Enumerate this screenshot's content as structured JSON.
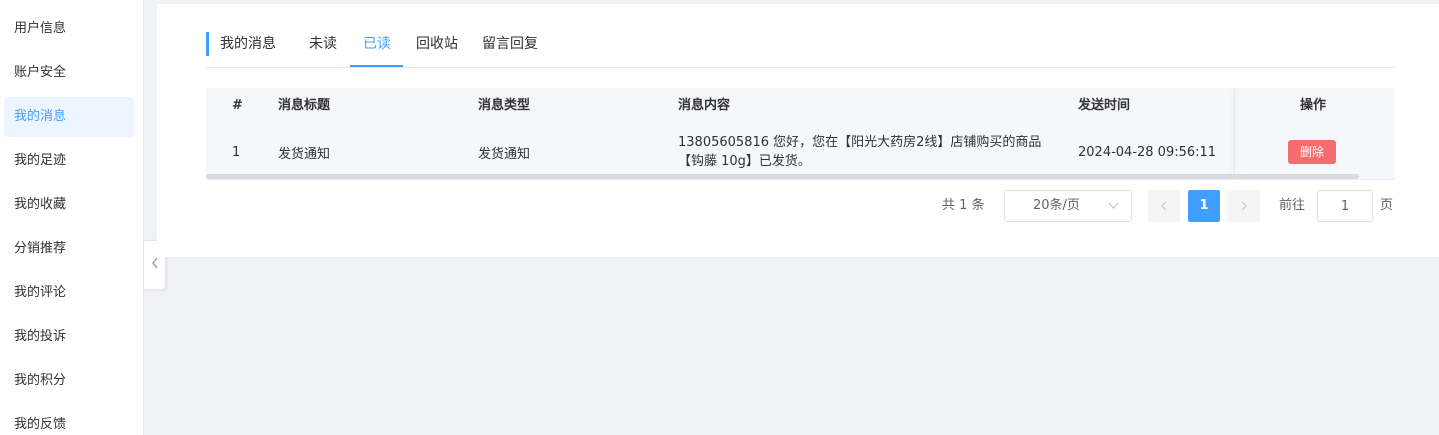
{
  "sidebar": {
    "items": [
      {
        "label": "用户信息"
      },
      {
        "label": "账户安全"
      },
      {
        "label": "我的消息"
      },
      {
        "label": "我的足迹"
      },
      {
        "label": "我的收藏"
      },
      {
        "label": "分销推荐"
      },
      {
        "label": "我的评论"
      },
      {
        "label": "我的投诉"
      },
      {
        "label": "我的积分"
      },
      {
        "label": "我的反馈"
      }
    ],
    "active_item": "我的消息"
  },
  "collapse_icon": "chevron-left-icon",
  "tabs": {
    "items": [
      {
        "label": "我的消息"
      },
      {
        "label": "未读"
      },
      {
        "label": "已读"
      },
      {
        "label": "回收站"
      },
      {
        "label": "留言回复"
      }
    ],
    "active_tab": "已读"
  },
  "table": {
    "headers": [
      "#",
      "消息标题",
      "消息类型",
      "消息内容",
      "发送时间",
      "操作"
    ],
    "rows": [
      {
        "index": "1",
        "title": "发货通知",
        "type": "发货通知",
        "content": "13805605816 您好，您在【阳光大药房2线】店铺购买的商品【钩藤 10g】已发货。",
        "time": "2024-04-28 09:56:11",
        "action_label": "删除"
      }
    ]
  },
  "pagination": {
    "total_text": "共 1 条",
    "page_size": "20条/页",
    "current_page": "1",
    "goto_label": "前往",
    "goto_value": "1",
    "page_unit": "页"
  },
  "colors": {
    "primary": "#409eff",
    "danger": "#f56c6c",
    "active_bg": "#ecf5ff"
  }
}
